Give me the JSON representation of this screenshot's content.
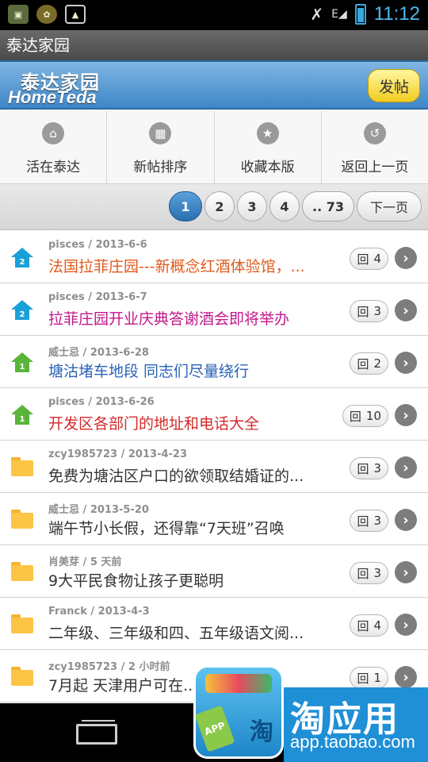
{
  "status_bar": {
    "time": "11:12",
    "left_icons": [
      "sim-card-icon",
      "game-icon",
      "image-icon"
    ],
    "right_icons": [
      "vibrate-icon",
      "signal-icon",
      "battery-icon"
    ],
    "network_label": "E"
  },
  "app_title": "泰达家园",
  "header": {
    "logo_cn": "泰达家园",
    "logo_en": "HomeTeda",
    "post_button": "发帖"
  },
  "nav": [
    {
      "label": "活在泰达",
      "icon": "home-icon",
      "glyph": "⌂"
    },
    {
      "label": "新帖排序",
      "icon": "grid-icon",
      "glyph": "▦"
    },
    {
      "label": "收藏本版",
      "icon": "star-icon",
      "glyph": "★"
    },
    {
      "label": "返回上一页",
      "icon": "back-icon",
      "glyph": "↺"
    }
  ],
  "pagination": {
    "pages": [
      "1",
      "2",
      "3",
      "4",
      ".. 73"
    ],
    "current": "1",
    "next_label": "下一页"
  },
  "posts": [
    {
      "author": "pisces",
      "date": "2013-6-6",
      "title": "法国拉菲庄园---新概念红酒体验馆，...",
      "replies": "4",
      "icon": "pinned-2-icon",
      "title_color": "#e05a1c"
    },
    {
      "author": "pisces",
      "date": "2013-6-7",
      "title": "拉菲庄园开业庆典答谢酒会即将举办",
      "replies": "3",
      "icon": "pinned-2-icon",
      "title_color": "#c2188a"
    },
    {
      "author": "威士忌",
      "date": "2013-6-28",
      "title": "塘沽堵车地段 同志们尽量绕行",
      "replies": "2",
      "icon": "pinned-1-icon",
      "title_color": "#2a62b8"
    },
    {
      "author": "pisces",
      "date": "2013-6-26",
      "title": "开发区各部门的地址和电话大全",
      "replies": "10",
      "icon": "pinned-1-icon",
      "title_color": "#d22a2a"
    },
    {
      "author": "zcy1985723",
      "date": "2013-4-23",
      "title": "免费为塘沽区户口的欲领取结婚证的...",
      "replies": "3",
      "icon": "folder-icon",
      "title_color": "#333333"
    },
    {
      "author": "威士忌",
      "date": "2013-5-20",
      "title": "端午节小长假，还得靠“7天班”召唤",
      "replies": "3",
      "icon": "folder-icon",
      "title_color": "#333333"
    },
    {
      "author": "肖美芽",
      "date": "5 天前",
      "title": "9大平民食物让孩子更聪明",
      "replies": "3",
      "icon": "folder-icon",
      "title_color": "#333333"
    },
    {
      "author": "Franck",
      "date": "2013-4-3",
      "title": "二年级、三年级和四、五年级语文阅...",
      "replies": "4",
      "icon": "folder-icon",
      "title_color": "#333333"
    },
    {
      "author": "zcy1985723",
      "date": "2 小时前",
      "title": "7月起 天津用户可在...卡办...",
      "replies": "1",
      "icon": "folder-icon",
      "title_color": "#333333"
    }
  ],
  "reply_prefix": "回",
  "overlay": {
    "brand": "淘应用",
    "url": "app.taobao.com",
    "tag": "APP",
    "bag_char": "淘"
  }
}
